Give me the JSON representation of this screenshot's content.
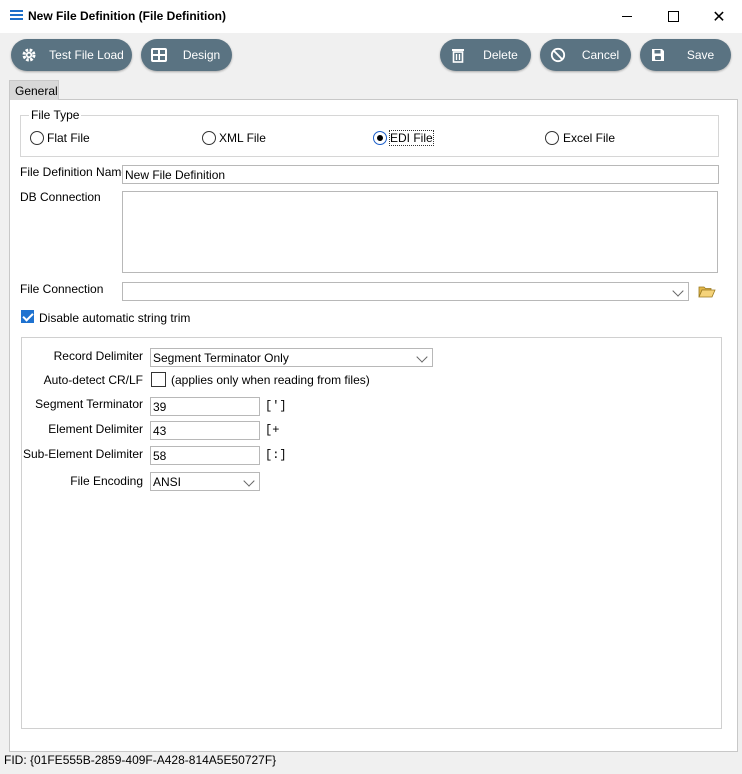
{
  "window": {
    "title": "New File Definition (File Definition)"
  },
  "toolbar": {
    "test_file_load": "Test File Load",
    "design": "Design",
    "delete": "Delete",
    "cancel": "Cancel",
    "save": "Save",
    "accent_color": "#5a7382"
  },
  "tabs": {
    "general": "General"
  },
  "file_type": {
    "legend": "File Type",
    "options": [
      "Flat File",
      "XML File",
      "EDI File",
      "Excel File"
    ],
    "selected": "EDI File"
  },
  "form": {
    "file_definition_name_label": "File Definition Name",
    "file_definition_name_value": "New File Definition",
    "db_connection_label": "DB Connection",
    "db_connection_value": "",
    "file_connection_label": "File Connection",
    "file_connection_value": "",
    "disable_trim_label": "Disable automatic string trim",
    "disable_trim_checked": true
  },
  "edi": {
    "record_delimiter_label": "Record Delimiter",
    "record_delimiter_value": "Segment Terminator Only",
    "auto_detect_label": "Auto-detect CR/LF",
    "auto_detect_note": "(applies only when reading from files)",
    "auto_detect_checked": false,
    "segment_terminator_label": "Segment Terminator",
    "segment_terminator_value": "39",
    "segment_terminator_char": "[']",
    "element_delimiter_label": "Element Delimiter",
    "element_delimiter_value": "43",
    "element_delimiter_char": "[+",
    "sub_element_delimiter_label": "Sub-Element Delimiter",
    "sub_element_delimiter_value": "58",
    "sub_element_delimiter_char": "[:]",
    "file_encoding_label": "File Encoding",
    "file_encoding_value": "ANSI"
  },
  "status": {
    "fid": "FID: {01FE555B-2859-409F-A428-814A5E50727F}"
  }
}
